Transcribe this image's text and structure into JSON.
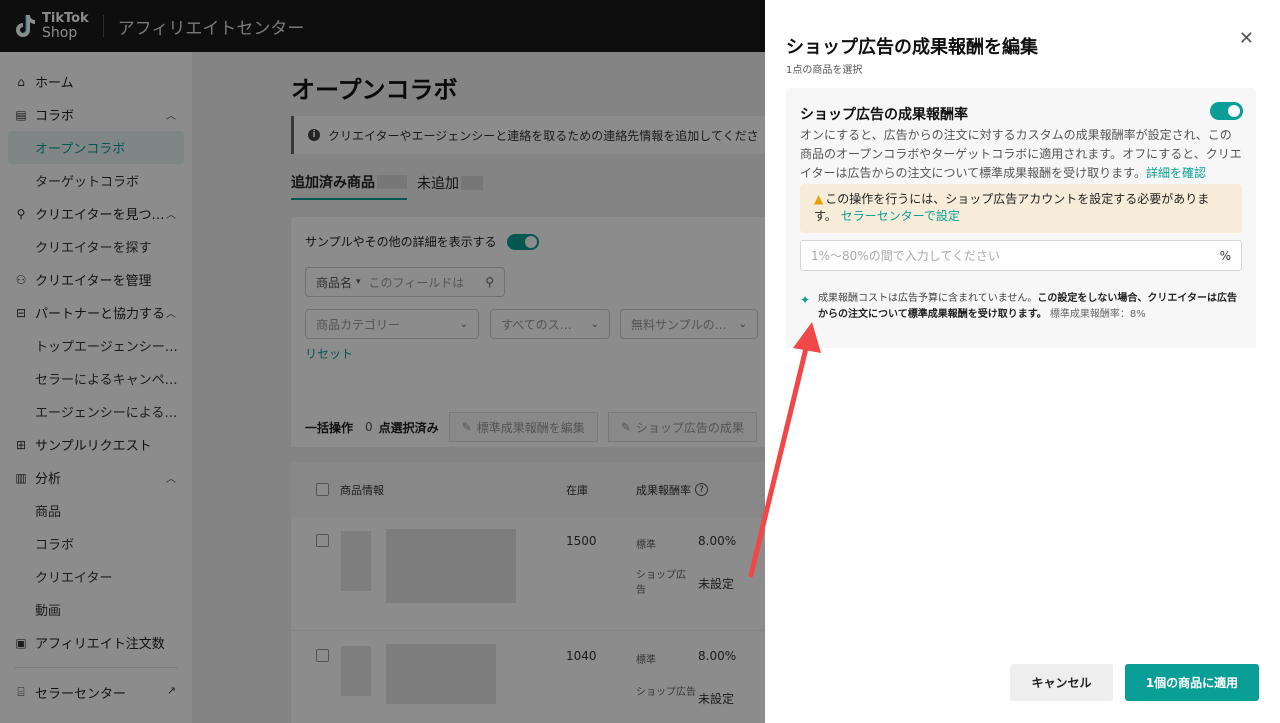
{
  "header": {
    "logo_top": "TikTok",
    "logo_bottom": "Shop",
    "app_title": "アフィリエイトセンター"
  },
  "sidebar": {
    "home": "ホーム",
    "collab": "コラボ",
    "open_collab": "オープンコラボ",
    "target_collab": "ターゲットコラボ",
    "find_creators": "クリエイターを見つ…",
    "search_creators": "クリエイターを探す",
    "manage_creators": "クリエイターを管理",
    "partners": "パートナーと協力する",
    "top_agency": "トップエージェンシー…",
    "seller_campaign": "セラーによるキャンペ…",
    "agency_by": "エージェンシーによる…",
    "sample_request": "サンプルリクエスト",
    "analytics": "分析",
    "an_products": "商品",
    "an_collab": "コラボ",
    "an_creators": "クリエイター",
    "an_video": "動画",
    "affiliate_orders": "アフィリエイト注文数",
    "seller_center": "セラーセンター"
  },
  "main": {
    "page_title": "オープンコラボ",
    "info_text": "クリエイターやエージェンシーと連絡を取るための連絡先情報を追加してくださ",
    "tab_added": "追加済み商品",
    "tab_not_added": "未追加",
    "sample_toggle_label": "サンプルやその他の詳細を表示する",
    "product_name_select": "商品名",
    "field_placeholder": "このフィールドは",
    "category_select": "商品カテゴリー",
    "all_select": "すべてのス…",
    "free_sample_select": "無料サンプルの…",
    "reset": "リセット",
    "bulk_label": "一括操作",
    "selected_count": "0",
    "selected_suffix": "点選択済み",
    "bulk_edit_std": "標準成果報酬を編集",
    "bulk_edit_shop": "ショップ広告の成果",
    "table": {
      "col_product": "商品情報",
      "col_stock": "在庫",
      "col_commission": "成果報酬率",
      "rows": [
        {
          "stock": "1500",
          "std_label": "標準",
          "std_value": "8.00%",
          "shop_label": "ショップ広告",
          "shop_value": "未設定"
        },
        {
          "stock": "1040",
          "std_label": "標準",
          "std_value": "8.00%",
          "shop_label": "ショップ広告",
          "shop_value": "未設定"
        }
      ]
    }
  },
  "drawer": {
    "title": "ショップ広告の成果報酬を編集",
    "subtitle": "1点の商品を選択",
    "setting_title": "ショップ広告の成果報酬率",
    "toggle_on": true,
    "description": "オンにすると、広告からの注文に対するカスタムの成果報酬率が設定され、この商品のオープンコラボやターゲットコラボに適用されます。オフにすると、クリエイターは広告からの注文について標準成果報酬を受け取ります。",
    "learn_more": "詳細を確認",
    "warning_text": "この操作を行うには、ショップ広告アカウントを設定する必要があります。",
    "warning_link": "セラーセンターで設定",
    "input_placeholder": "1%〜80%の間で入力してください",
    "input_unit": "%",
    "note_text": "成果報酬コストは広告予算に含まれていません。",
    "note_bold": "この設定をしない場合、クリエイターは広告からの注文について標準成果報酬を受け取ります。",
    "note_std": "標準成果報酬率：8%",
    "cancel": "キャンセル",
    "apply": "1個の商品に適用"
  },
  "colors": {
    "accent": "#0a9f96",
    "warning_bg": "#f6ecd9",
    "annotation_arrow": "#f04848"
  }
}
